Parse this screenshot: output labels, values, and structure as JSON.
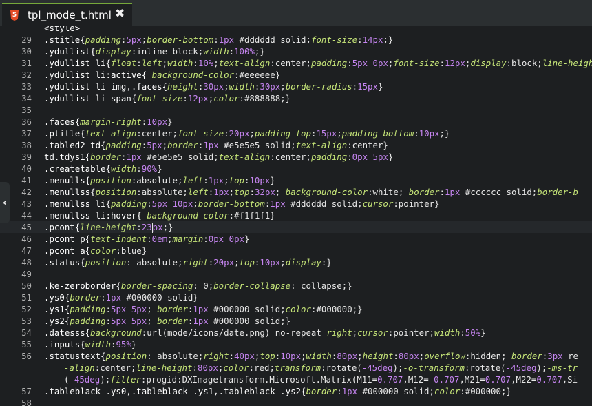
{
  "tab": {
    "title": "tpl_mode_t.html",
    "file_type": "5",
    "close_glyph": "✖"
  },
  "sidebar_toggle": {
    "glyph": "‹"
  },
  "colors": {
    "background": "#1d1f21",
    "tabbar": "#2b2f31",
    "tab_accent": "#76a83a",
    "selector": "#ffffff",
    "property": "#c5e478",
    "number": "#c585f0",
    "line_number": "#b0b0b0"
  },
  "active_line": "45",
  "lines": [
    {
      "n": "",
      "top_partial": true,
      "segs": [
        [
          "s",
          "<style>"
        ]
      ]
    },
    {
      "n": "29",
      "segs": [
        [
          "s",
          ".stitle{"
        ],
        [
          "p",
          "padding"
        ],
        [
          "t",
          ":"
        ],
        [
          "u",
          "5px"
        ],
        [
          "t",
          ";"
        ],
        [
          "p",
          "border-bottom"
        ],
        [
          "t",
          ":"
        ],
        [
          "u",
          "1px"
        ],
        [
          "t",
          " #dddddd solid;"
        ],
        [
          "p",
          "font-size"
        ],
        [
          "t",
          ":"
        ],
        [
          "u",
          "14px"
        ],
        [
          "t",
          ";}"
        ]
      ]
    },
    {
      "n": "30",
      "segs": [
        [
          "s",
          ".ydullist{"
        ],
        [
          "p",
          "display"
        ],
        [
          "t",
          ":inline-block;"
        ],
        [
          "p",
          "width"
        ],
        [
          "t",
          ":"
        ],
        [
          "u",
          "100%"
        ],
        [
          "t",
          ";}"
        ]
      ]
    },
    {
      "n": "31",
      "segs": [
        [
          "s",
          ".ydullist li{"
        ],
        [
          "p",
          "float"
        ],
        [
          "t",
          ":"
        ],
        [
          "p",
          "left"
        ],
        [
          "t",
          ";"
        ],
        [
          "p",
          "width"
        ],
        [
          "t",
          ":"
        ],
        [
          "u",
          "10%"
        ],
        [
          "t",
          ";"
        ],
        [
          "p",
          "text-align"
        ],
        [
          "t",
          ":center;"
        ],
        [
          "p",
          "padding"
        ],
        [
          "t",
          ":"
        ],
        [
          "u",
          "5px 0px"
        ],
        [
          "t",
          ";"
        ],
        [
          "p",
          "font-size"
        ],
        [
          "t",
          ":"
        ],
        [
          "u",
          "12px"
        ],
        [
          "t",
          ";"
        ],
        [
          "p",
          "display"
        ],
        [
          "t",
          ":block;"
        ],
        [
          "p",
          "line-height"
        ]
      ]
    },
    {
      "n": "32",
      "segs": [
        [
          "s",
          ".ydullist li:active{ "
        ],
        [
          "p",
          "background-color"
        ],
        [
          "t",
          ":#eeeeee}"
        ]
      ]
    },
    {
      "n": "33",
      "segs": [
        [
          "s",
          ".ydullist li img,.faces{"
        ],
        [
          "p",
          "height"
        ],
        [
          "t",
          ":"
        ],
        [
          "u",
          "30px"
        ],
        [
          "t",
          ";"
        ],
        [
          "p",
          "width"
        ],
        [
          "t",
          ":"
        ],
        [
          "u",
          "30px"
        ],
        [
          "t",
          ";"
        ],
        [
          "p",
          "border-radius"
        ],
        [
          "t",
          ":"
        ],
        [
          "u",
          "15px"
        ],
        [
          "t",
          "}"
        ]
      ]
    },
    {
      "n": "34",
      "segs": [
        [
          "s",
          ".ydullist li span{"
        ],
        [
          "p",
          "font-size"
        ],
        [
          "t",
          ":"
        ],
        [
          "u",
          "12px"
        ],
        [
          "t",
          ";"
        ],
        [
          "p",
          "color"
        ],
        [
          "t",
          ":#888888;}"
        ]
      ]
    },
    {
      "n": "35",
      "segs": []
    },
    {
      "n": "36",
      "segs": [
        [
          "s",
          ".faces{"
        ],
        [
          "p",
          "margin-right"
        ],
        [
          "t",
          ":"
        ],
        [
          "u",
          "10px"
        ],
        [
          "t",
          "}"
        ]
      ]
    },
    {
      "n": "37",
      "segs": [
        [
          "s",
          ".ptitle{"
        ],
        [
          "p",
          "text-align"
        ],
        [
          "t",
          ":center;"
        ],
        [
          "p",
          "font-size"
        ],
        [
          "t",
          ":"
        ],
        [
          "u",
          "20px"
        ],
        [
          "t",
          ";"
        ],
        [
          "p",
          "padding-top"
        ],
        [
          "t",
          ":"
        ],
        [
          "u",
          "15px"
        ],
        [
          "t",
          ";"
        ],
        [
          "p",
          "padding-bottom"
        ],
        [
          "t",
          ":"
        ],
        [
          "u",
          "10px"
        ],
        [
          "t",
          ";}"
        ]
      ]
    },
    {
      "n": "38",
      "segs": [
        [
          "s",
          ".tabled2 td{"
        ],
        [
          "p",
          "padding"
        ],
        [
          "t",
          ":"
        ],
        [
          "u",
          "5px"
        ],
        [
          "t",
          ";"
        ],
        [
          "p",
          "border"
        ],
        [
          "t",
          ":"
        ],
        [
          "u",
          "1px"
        ],
        [
          "t",
          " #e5e5e5 solid;"
        ],
        [
          "p",
          "text-align"
        ],
        [
          "t",
          ":center}"
        ]
      ]
    },
    {
      "n": "39",
      "segs": [
        [
          "s",
          "td.tdys1{"
        ],
        [
          "p",
          "border"
        ],
        [
          "t",
          ":"
        ],
        [
          "u",
          "1px"
        ],
        [
          "t",
          " #e5e5e5 solid;"
        ],
        [
          "p",
          "text-align"
        ],
        [
          "t",
          ":center;"
        ],
        [
          "p",
          "padding"
        ],
        [
          "t",
          ":"
        ],
        [
          "u",
          "0px 5px"
        ],
        [
          "t",
          "}"
        ]
      ]
    },
    {
      "n": "40",
      "segs": [
        [
          "s",
          ".createtable{"
        ],
        [
          "p",
          "width"
        ],
        [
          "t",
          ":"
        ],
        [
          "u",
          "90%"
        ],
        [
          "t",
          "}"
        ]
      ]
    },
    {
      "n": "41",
      "segs": [
        [
          "s",
          ".menulls{"
        ],
        [
          "p",
          "position"
        ],
        [
          "t",
          ":absolute;"
        ],
        [
          "p",
          "left"
        ],
        [
          "t",
          ":"
        ],
        [
          "u",
          "1px"
        ],
        [
          "t",
          ";"
        ],
        [
          "p",
          "top"
        ],
        [
          "t",
          ":"
        ],
        [
          "u",
          "10px"
        ],
        [
          "t",
          "}"
        ]
      ]
    },
    {
      "n": "42",
      "segs": [
        [
          "s",
          ".menullss{"
        ],
        [
          "p",
          "position"
        ],
        [
          "t",
          ":absolute;"
        ],
        [
          "p",
          "left"
        ],
        [
          "t",
          ":"
        ],
        [
          "u",
          "1px"
        ],
        [
          "t",
          ";"
        ],
        [
          "p",
          "top"
        ],
        [
          "t",
          ":"
        ],
        [
          "u",
          "32px"
        ],
        [
          "t",
          "; "
        ],
        [
          "p",
          "background-color"
        ],
        [
          "t",
          ":white; "
        ],
        [
          "p",
          "border"
        ],
        [
          "t",
          ":"
        ],
        [
          "u",
          "1px"
        ],
        [
          "t",
          " #cccccc solid;"
        ],
        [
          "p",
          "border-b"
        ]
      ]
    },
    {
      "n": "43",
      "segs": [
        [
          "s",
          ".menullss li{"
        ],
        [
          "p",
          "padding"
        ],
        [
          "t",
          ":"
        ],
        [
          "u",
          "5px 10px"
        ],
        [
          "t",
          ";"
        ],
        [
          "p",
          "border-bottom"
        ],
        [
          "t",
          ":"
        ],
        [
          "u",
          "1px"
        ],
        [
          "t",
          " #dddddd solid;"
        ],
        [
          "p",
          "cursor"
        ],
        [
          "t",
          ":pointer}"
        ]
      ]
    },
    {
      "n": "44",
      "segs": [
        [
          "s",
          ".menullss li:hover{ "
        ],
        [
          "p",
          "background-color"
        ],
        [
          "t",
          ":#f1f1f1}"
        ]
      ]
    },
    {
      "n": "45",
      "active": true,
      "segs": [
        [
          "s",
          ".pcont{"
        ],
        [
          "p",
          "line-height"
        ],
        [
          "t",
          ":"
        ],
        [
          "u",
          "23"
        ],
        [
          "c",
          ""
        ],
        [
          "u",
          "px"
        ],
        [
          "t",
          ";}"
        ]
      ]
    },
    {
      "n": "46",
      "segs": [
        [
          "s",
          ".pcont p{"
        ],
        [
          "p",
          "text-indent"
        ],
        [
          "t",
          ":"
        ],
        [
          "u",
          "0em"
        ],
        [
          "t",
          ";"
        ],
        [
          "p",
          "margin"
        ],
        [
          "t",
          ":"
        ],
        [
          "u",
          "0px 0px"
        ],
        [
          "t",
          "}"
        ]
      ]
    },
    {
      "n": "47",
      "segs": [
        [
          "s",
          ".pcont a{"
        ],
        [
          "p",
          "color"
        ],
        [
          "t",
          ":blue}"
        ]
      ]
    },
    {
      "n": "48",
      "segs": [
        [
          "s",
          ".status{"
        ],
        [
          "p",
          "position"
        ],
        [
          "t",
          ": absolute;"
        ],
        [
          "p",
          "right"
        ],
        [
          "t",
          ":"
        ],
        [
          "u",
          "20px"
        ],
        [
          "t",
          ";"
        ],
        [
          "p",
          "top"
        ],
        [
          "t",
          ":"
        ],
        [
          "u",
          "10px"
        ],
        [
          "t",
          ";"
        ],
        [
          "p",
          "display"
        ],
        [
          "t",
          ":}"
        ]
      ]
    },
    {
      "n": "49",
      "segs": []
    },
    {
      "n": "50",
      "segs": [
        [
          "s",
          ".ke-zeroborder{"
        ],
        [
          "p",
          "border-spacing"
        ],
        [
          "t",
          ": 0;"
        ],
        [
          "p",
          "border-collapse"
        ],
        [
          "t",
          ": collapse;}"
        ]
      ]
    },
    {
      "n": "51",
      "segs": [
        [
          "s",
          ".ys0{"
        ],
        [
          "p",
          "border"
        ],
        [
          "t",
          ":"
        ],
        [
          "u",
          "1px"
        ],
        [
          "t",
          " #000000 solid}"
        ]
      ]
    },
    {
      "n": "52",
      "segs": [
        [
          "s",
          ".ys1{"
        ],
        [
          "p",
          "padding"
        ],
        [
          "t",
          ":"
        ],
        [
          "u",
          "5px 5px"
        ],
        [
          "t",
          "; "
        ],
        [
          "p",
          "border"
        ],
        [
          "t",
          ":"
        ],
        [
          "u",
          "1px"
        ],
        [
          "t",
          " #000000 solid;"
        ],
        [
          "p",
          "color"
        ],
        [
          "t",
          ":#000000;}"
        ]
      ]
    },
    {
      "n": "53",
      "segs": [
        [
          "s",
          ".ys2{"
        ],
        [
          "p",
          "padding"
        ],
        [
          "t",
          ":"
        ],
        [
          "u",
          "5px 5px"
        ],
        [
          "t",
          "; "
        ],
        [
          "p",
          "border"
        ],
        [
          "t",
          ":"
        ],
        [
          "u",
          "1px"
        ],
        [
          "t",
          " #000000 solid;}"
        ]
      ]
    },
    {
      "n": "54",
      "segs": [
        [
          "s",
          ".datesss{"
        ],
        [
          "p",
          "background"
        ],
        [
          "t",
          ":url(mode/icons/date.png) no-repeat "
        ],
        [
          "p",
          "right"
        ],
        [
          "t",
          ";"
        ],
        [
          "p",
          "cursor"
        ],
        [
          "t",
          ":pointer;"
        ],
        [
          "p",
          "width"
        ],
        [
          "t",
          ":"
        ],
        [
          "u",
          "50%"
        ],
        [
          "t",
          "}"
        ]
      ]
    },
    {
      "n": "55",
      "segs": [
        [
          "s",
          ".inputs{"
        ],
        [
          "p",
          "width"
        ],
        [
          "t",
          ":"
        ],
        [
          "u",
          "95%"
        ],
        [
          "t",
          "}"
        ]
      ]
    },
    {
      "n": "56",
      "segs": [
        [
          "s",
          ".statustext{"
        ],
        [
          "p",
          "position"
        ],
        [
          "t",
          ": absolute;"
        ],
        [
          "p",
          "right"
        ],
        [
          "t",
          ":"
        ],
        [
          "u",
          "40px"
        ],
        [
          "t",
          ";"
        ],
        [
          "p",
          "top"
        ],
        [
          "t",
          ":"
        ],
        [
          "u",
          "10px"
        ],
        [
          "t",
          ";"
        ],
        [
          "p",
          "width"
        ],
        [
          "t",
          ":"
        ],
        [
          "u",
          "80px"
        ],
        [
          "t",
          ";"
        ],
        [
          "p",
          "height"
        ],
        [
          "t",
          ":"
        ],
        [
          "u",
          "80px"
        ],
        [
          "t",
          ";"
        ],
        [
          "p",
          "overflow"
        ],
        [
          "t",
          ":hidden; "
        ],
        [
          "p",
          "border"
        ],
        [
          "t",
          ":"
        ],
        [
          "u",
          "3px"
        ],
        [
          "t",
          " re"
        ]
      ]
    },
    {
      "n": "",
      "wrap": true,
      "segs": [
        [
          "p",
          "-align"
        ],
        [
          "t",
          ":center;"
        ],
        [
          "p",
          "line-height"
        ],
        [
          "t",
          ":"
        ],
        [
          "u",
          "80px"
        ],
        [
          "t",
          ";"
        ],
        [
          "p",
          "color"
        ],
        [
          "t",
          ":red;"
        ],
        [
          "p",
          "transform"
        ],
        [
          "t",
          ":rotate("
        ],
        [
          "u",
          "-45deg"
        ],
        [
          "t",
          ");"
        ],
        [
          "p",
          "-o-transform"
        ],
        [
          "t",
          ":rotate("
        ],
        [
          "u",
          "-45deg"
        ],
        [
          "t",
          ");"
        ],
        [
          "p",
          "-ms-tr"
        ]
      ]
    },
    {
      "n": "",
      "wrap": true,
      "segs": [
        [
          "t",
          "("
        ],
        [
          "u",
          "-45deg"
        ],
        [
          "t",
          ");"
        ],
        [
          "p",
          "filter"
        ],
        [
          "t",
          ":progid:DXImagetransform.Microsoft.Matrix(M11="
        ],
        [
          "u",
          "0.707"
        ],
        [
          "t",
          ",M12="
        ],
        [
          "u",
          "-0.707"
        ],
        [
          "t",
          ",M21="
        ],
        [
          "u",
          "0.707"
        ],
        [
          "t",
          ",M22="
        ],
        [
          "u",
          "0.707"
        ],
        [
          "t",
          ",Si"
        ]
      ]
    },
    {
      "n": "57",
      "segs": [
        [
          "s",
          ".tableblack .ys0,.tableblack .ys1,.tableblack .ys2{"
        ],
        [
          "p",
          "border"
        ],
        [
          "t",
          ":"
        ],
        [
          "u",
          "1px"
        ],
        [
          "t",
          " #000000 solid;"
        ],
        [
          "p",
          "color"
        ],
        [
          "t",
          ":#000000;}"
        ]
      ]
    },
    {
      "n": "58",
      "bottom_partial": true,
      "segs": []
    }
  ]
}
